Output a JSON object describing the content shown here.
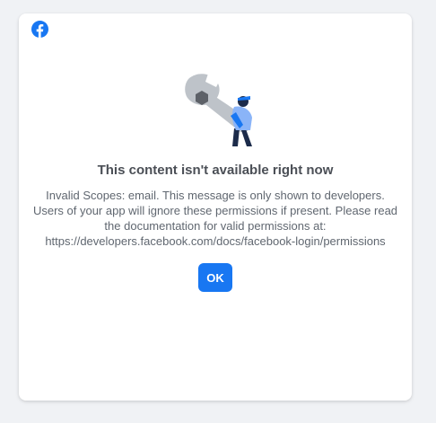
{
  "dialog": {
    "brand_icon": "facebook-icon",
    "illustration_icon": "wrench-with-person-illustration",
    "title": "This content isn't available right now",
    "message": "Invalid Scopes: email. This message is only shown to developers. Users of your app will ignore these permissions if present. Please read the documentation for valid permissions at: https://developers.facebook.com/docs/facebook-login/permissions",
    "ok_label": "OK"
  },
  "colors": {
    "page_background": "#f0f2f5",
    "dialog_background": "#ffffff",
    "brand_blue": "#1877f2",
    "title_text": "#4b4f56",
    "body_text": "#606770"
  }
}
